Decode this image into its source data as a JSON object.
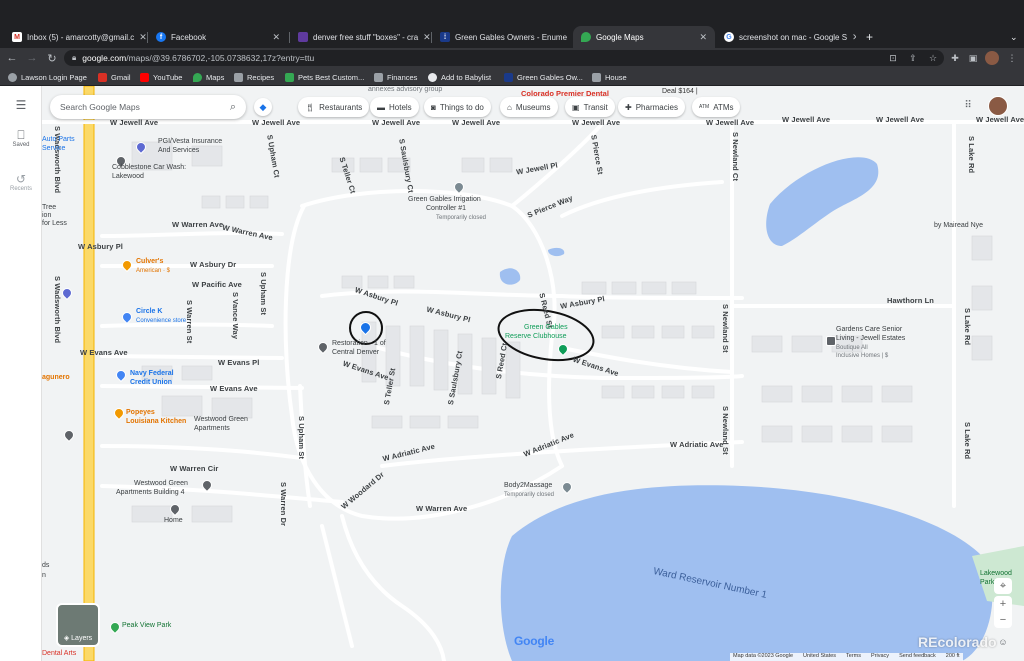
{
  "tabs": [
    {
      "label": "Inbox (5) - amarcotty@gmail.c",
      "icon": "gmail-icon",
      "color": "#d93025"
    },
    {
      "label": "Facebook",
      "icon": "facebook-icon",
      "color": "#1877f2"
    },
    {
      "label": "denver free stuff \"boxes\" - cra",
      "icon": "craigslist-icon",
      "color": "#5f3a9e"
    },
    {
      "label": "Green Gables Owners - Enume",
      "icon": "grid-icon",
      "color": "#1a3a8a"
    },
    {
      "label": "Google Maps",
      "icon": "maps-icon",
      "color": "#34a853"
    },
    {
      "label": "screenshot on mac - Google S",
      "icon": "google-icon",
      "color": "#ffffff"
    }
  ],
  "address": {
    "host": "google.com",
    "path": "/maps/@39.6786702,-105.0738632,17z?entry=ttu"
  },
  "bookmarks": [
    {
      "label": "Lawson Login Page",
      "color": "#9aa0a6"
    },
    {
      "label": "Gmail",
      "color": "#d93025"
    },
    {
      "label": "YouTube",
      "color": "#ff0000"
    },
    {
      "label": "Maps",
      "color": "#34a853"
    },
    {
      "label": "Recipes",
      "color": "#9aa0a6"
    },
    {
      "label": "Pets Best Custom...",
      "color": "#34a853"
    },
    {
      "label": "Finances",
      "color": "#9aa0a6"
    },
    {
      "label": "Add to Babylist",
      "color": "#e8eaed"
    },
    {
      "label": "Green Gables Ow...",
      "color": "#1a3a8a"
    },
    {
      "label": "House",
      "color": "#9aa0a6"
    }
  ],
  "sidebar": {
    "saved": "Saved",
    "recents": "Recents"
  },
  "search": {
    "placeholder": "Search Google Maps"
  },
  "chips": [
    "Restaurants",
    "Hotels",
    "Things to do",
    "Museums",
    "Transit",
    "Pharmacies",
    "ATMs"
  ],
  "roads": {
    "jewell": "W Jewell Ave",
    "wadsworth": "S Wadsworth Blvd",
    "asbury_pl": "W Asbury Pl",
    "asbury_dr": "W Asbury Dr",
    "warren_ave": "W Warren Ave",
    "pacific": "W Pacific Ave",
    "evans_ave": "W Evans Ave",
    "evans_pl": "W Evans Pl",
    "adriatic": "W Adriatic Ave",
    "warren_cir": "W Warren Cir",
    "woodard": "W Woodard Dr",
    "pierce_way": "S Pierce Way",
    "pierce_st": "S Pierce St",
    "jewell_pl": "W Jewell Pl",
    "teller_ct": "S Teller Ct",
    "saulsbury": "S Saulsbury Ct",
    "upham_ct": "S Upham Ct",
    "upham_st": "S Upham St",
    "reed_st": "S Reed St",
    "reed_ct": "S Reed Ct",
    "newland_ct": "S Newland Ct",
    "newland_st": "S Newland St",
    "lake_rd": "S Lake Rd",
    "vance": "S Vance Way",
    "warren_st": "S Warren St",
    "warren_dr": "S Warren Dr",
    "hawthorn": "Hawthorn Ln",
    "teller_st": "S Teller St",
    "jewell_right": "W Jewell Ave"
  },
  "places": {
    "colorado_dental": "Colorado Premier Dental",
    "pgi_1": "PGI/Vesta Insurance",
    "pgi_2": "And Services",
    "auto_parts_1": "Auto Parts",
    "auto_parts_2": "Service",
    "cobblestone_1": "Cobblestone Car Wash:",
    "cobblestone_2": "Lakewood",
    "tree_1": "Tree",
    "tree_2": "ion",
    "tree_3": "for Less",
    "irrigation_1": "Green Gables Irrigation",
    "irrigation_2": "Controller #1",
    "irrigation_3": "Temporarily closed",
    "culvers_1": "Culver's",
    "culvers_2": "American · $",
    "circle_k_1": "Circle K",
    "circle_k_2": "Convenience store",
    "restoration_1": "Restoration - 1 of",
    "restoration_2": "Central Denver",
    "clubhouse_1": "Green Gables",
    "clubhouse_2": "Reserve Clubhouse",
    "gardens_1": "Gardens Care Senior",
    "gardens_2": "Living - Jewell Estates",
    "gardens_3": "Boutique All",
    "gardens_4": "Inclusive Homes | $",
    "navy_1": "Navy Federal",
    "navy_2": "Credit Union",
    "popeyes_1": "Popeyes",
    "popeyes_2": "Louisiana Kitchen",
    "westwood_1": "Westwood Green",
    "westwood_2": "Apartments",
    "westwood4_1": "Westwood Green",
    "westwood4_2": "Apartments Building 4",
    "body2massage_1": "Body2Massage",
    "body2massage_2": "Temporarily closed",
    "home": "Home",
    "peak_view": "Peak View Park",
    "ward": "Ward Reservoir Number 1",
    "mairead": "by Mairead Nye",
    "lakewood_1": "Lakewood",
    "lakewood_2": "Park",
    "agunero": "agunero",
    "deal": "Deal $164 |",
    "dental_arts": "Dental Arts",
    "annexes": "annexes advisory group",
    "frag_1": "ds",
    "frag_2": "n"
  },
  "layers": "Layers",
  "attribution": [
    "Map data ©2023 Google",
    "United States",
    "Terms",
    "Privacy",
    "Send feedback",
    "200 ft"
  ],
  "google_logo": "Google",
  "watermark": "REcolorado",
  "colors": {
    "accent": "#1a73e8",
    "water": "#9fbff0",
    "annotation": "#111111"
  }
}
